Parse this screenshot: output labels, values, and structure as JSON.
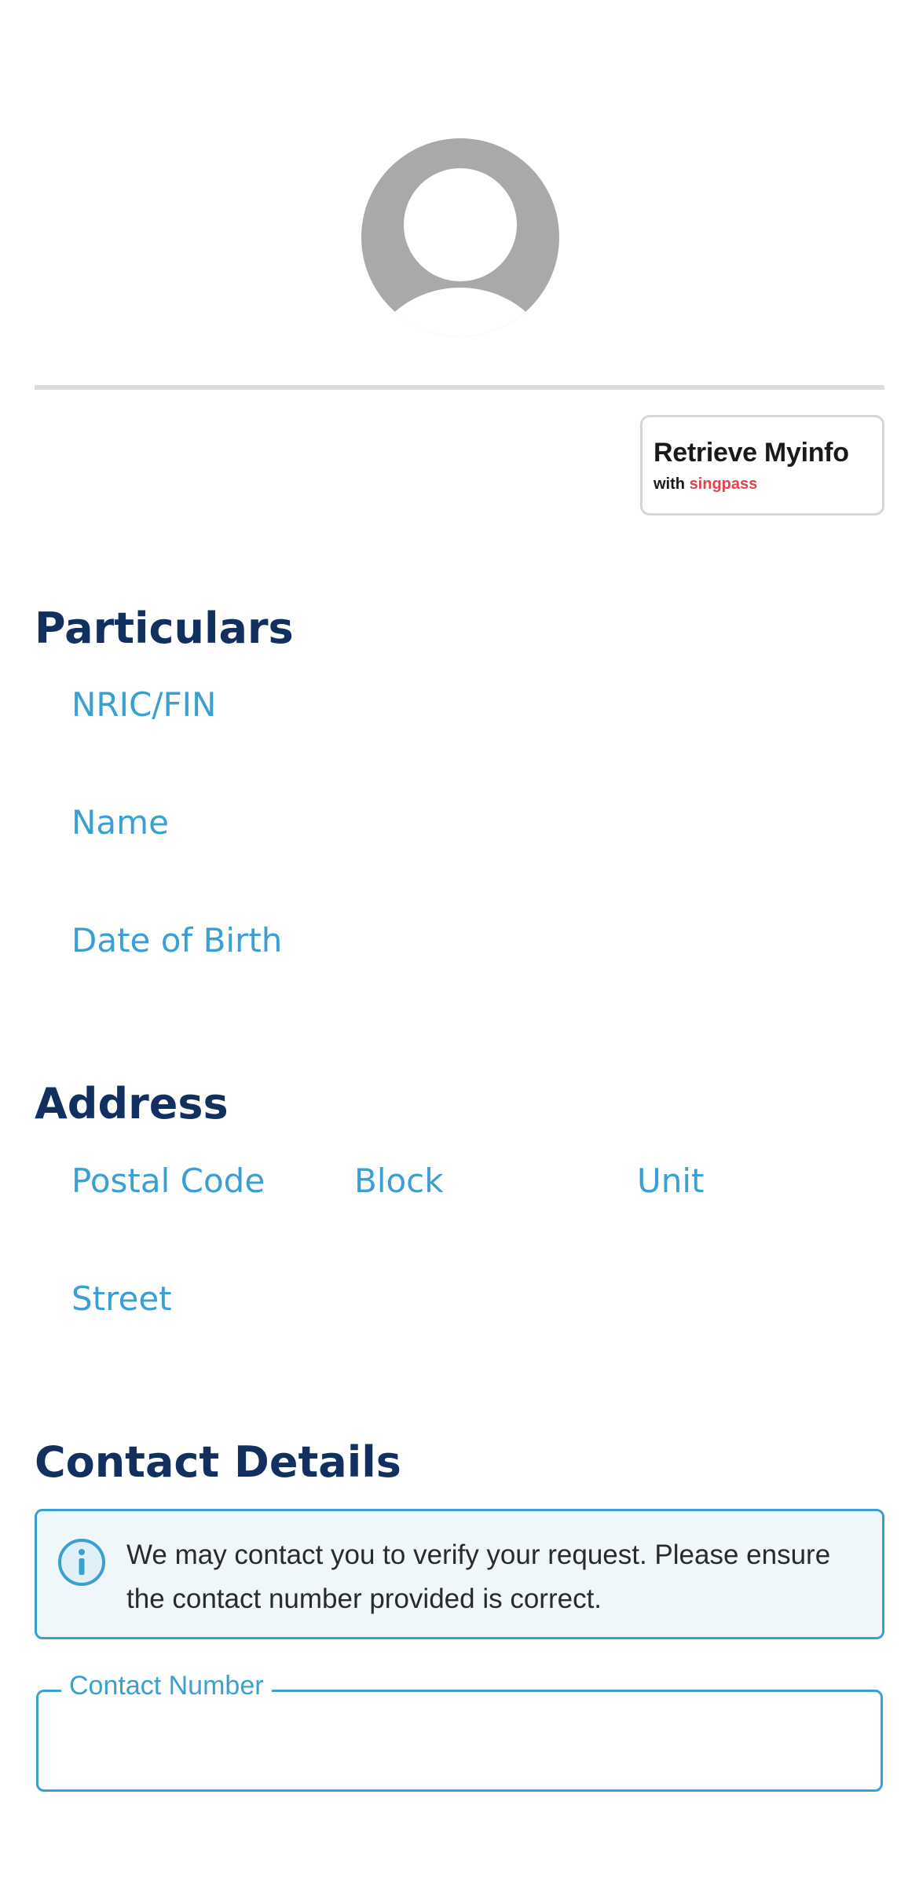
{
  "profile": {
    "avatar_icon": "user-avatar-icon"
  },
  "myinfo_button": {
    "title": "Retrieve Myinfo",
    "with_label": "with",
    "brand_label": "singpass"
  },
  "particulars": {
    "title": "Particulars",
    "nric_label": "NRIC/FIN",
    "nric_value": "",
    "name_label": "Name",
    "name_value": "",
    "dob_label": "Date of Birth",
    "dob_value": ""
  },
  "address": {
    "title": "Address",
    "postal_code_label": "Postal Code",
    "postal_code_value": "",
    "block_label": "Block",
    "block_value": "",
    "unit_label": "Unit",
    "unit_value": "",
    "street_label": "Street",
    "street_value": ""
  },
  "contact": {
    "title": "Contact Details",
    "info_icon": "info-icon",
    "info_text": "We may contact you to verify your request. Please ensure the contact number provided is correct.",
    "number_label": "Contact Number",
    "number_value": ""
  },
  "colors": {
    "heading": "#12305f",
    "label": "#3aa0d4",
    "info_bg": "#f0f7fa",
    "singpass_red": "#e3434c"
  }
}
